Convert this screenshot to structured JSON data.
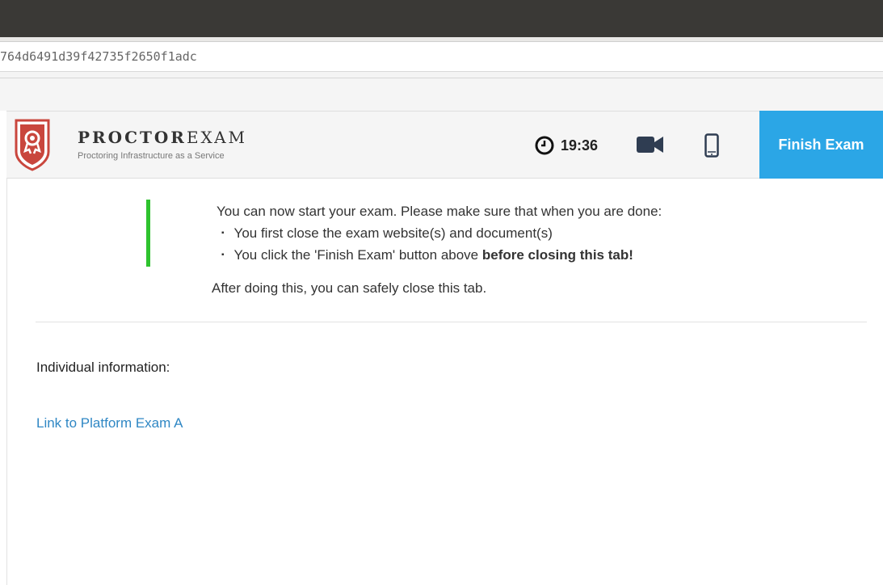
{
  "browser": {
    "url_text": "764d6491d39f42735f2650f1adc"
  },
  "header": {
    "brand_bold": "PROCTOR",
    "brand_light": "EXAM",
    "tagline": "Proctoring Infrastructure as a Service",
    "timer": "19:36",
    "finish_label": "Finish Exam",
    "icons": [
      "shield-logo-icon",
      "clock-icon",
      "video-camera-icon",
      "mobile-phone-icon"
    ],
    "accent_color": "#2ba6e6",
    "logo_color": "#c9463d"
  },
  "main": {
    "intro": "You can now start your exam. Please make sure that when you are done:",
    "bullet1": "You first close the exam website(s) and document(s)",
    "bullet2_prefix": "You click the 'Finish Exam' button above ",
    "bullet2_bold": "before closing this tab!",
    "after": "After doing this, you can safely close this tab.",
    "individual_info": "Individual information:",
    "exam_link": "Link to Platform Exam A",
    "indicator_color": "#2ec32e"
  }
}
